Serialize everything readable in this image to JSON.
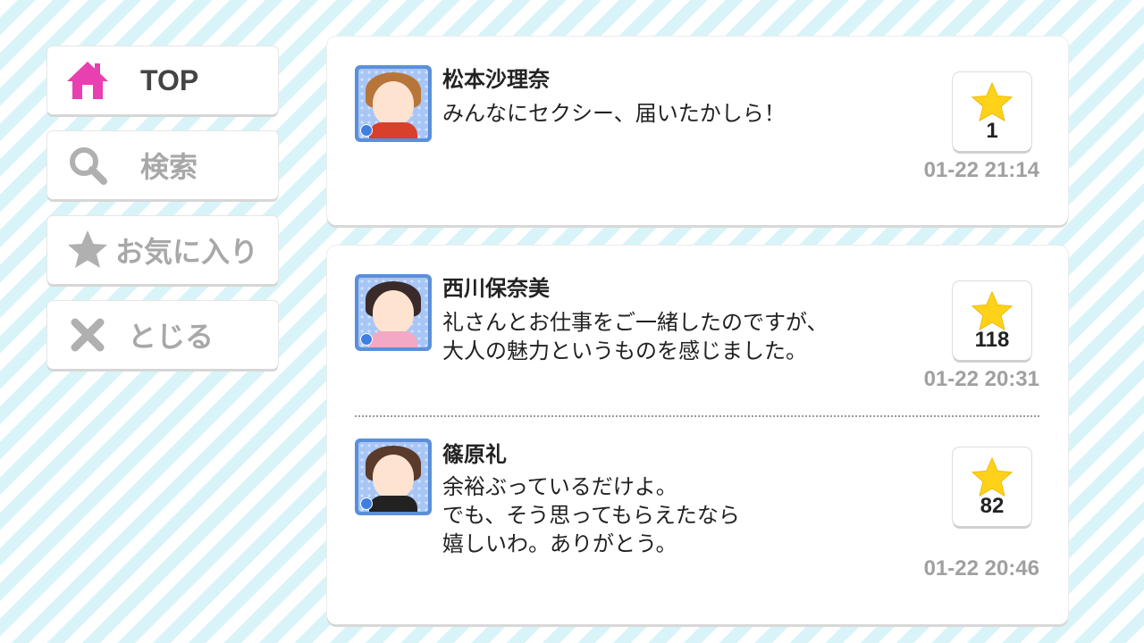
{
  "sidebar": {
    "items": [
      {
        "label": "TOP",
        "icon": "home-icon",
        "color": "#e840b0"
      },
      {
        "label": "検索",
        "icon": "search-icon",
        "color": "#b0b0b0"
      },
      {
        "label": "お気に入り",
        "icon": "star-icon",
        "color": "#b0b0b0"
      },
      {
        "label": "とじる",
        "icon": "close-icon",
        "color": "#b0b0b0"
      }
    ]
  },
  "posts": [
    {
      "name": "松本沙理奈",
      "message": "みんなにセクシー、届いたかしら！",
      "likes": "1",
      "time": "01-22 21:14"
    },
    {
      "name": "西川保奈美",
      "message": "礼さんとお仕事をご一緒したのですが、\n大人の魅力というものを感じました。",
      "likes": "118",
      "time": "01-22 20:31"
    },
    {
      "name": "篠原礼",
      "message": "余裕ぶっているだけよ。\nでも、そう思ってもらえたなら\n嬉しいわ。ありがとう。",
      "likes": "82",
      "time": "01-22 20:46"
    }
  ],
  "colors": {
    "star": "#ffd21a",
    "accent": "#e840b0",
    "avatar_frame": "#5b8fdc"
  }
}
